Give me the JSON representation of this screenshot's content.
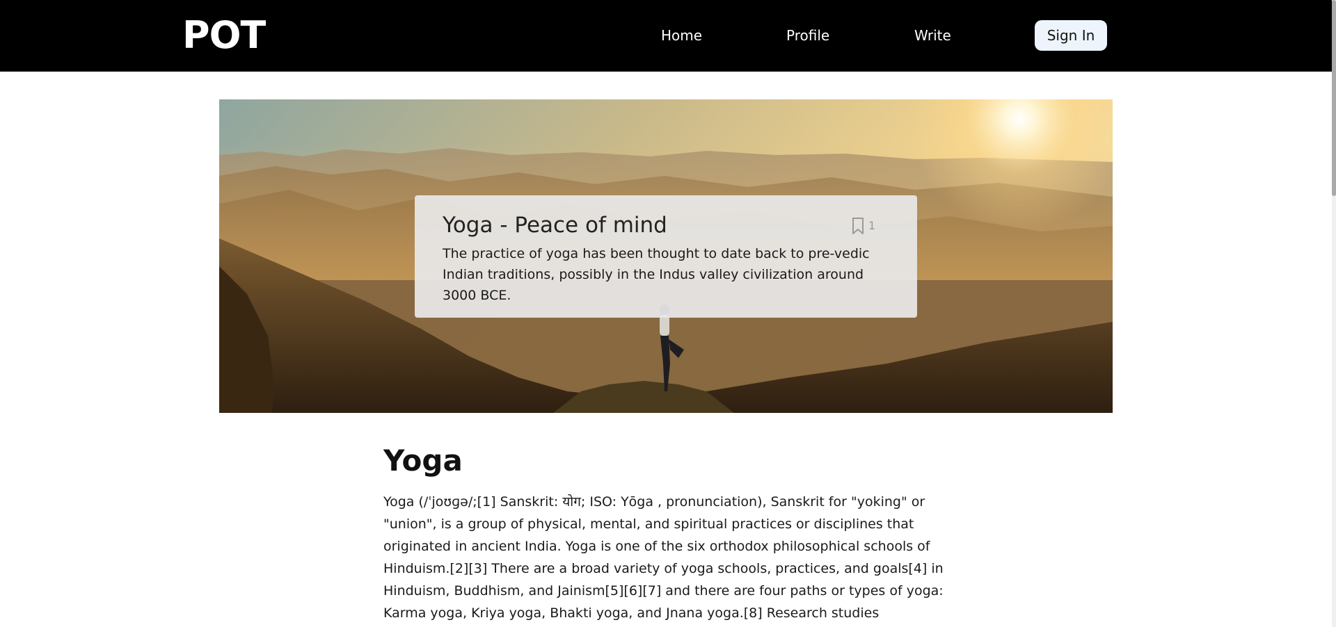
{
  "navbar": {
    "logo": "POT",
    "links": [
      {
        "label": "Home"
      },
      {
        "label": "Profile"
      },
      {
        "label": "Write"
      }
    ],
    "signin_label": "Sign In"
  },
  "hero": {
    "card": {
      "title": "Yoga - Peace of mind",
      "bookmark_icon": "bookmark-icon",
      "bookmark_count": "1",
      "description": "The practice of yoga has been thought to date back to pre-vedic Indian traditions, possibly in the Indus valley civilization around 3000 BCE."
    }
  },
  "article": {
    "title": "Yoga",
    "body": "Yoga (/ˈjoʊɡə/;[1] Sanskrit: योग; ISO: Yōga , pronunciation), Sanskrit for \"yoking\" or \"union\", is a group of physical, mental, and spiritual practices or disciplines that originated in ancient India. Yoga is one of the six orthodox philosophical schools of Hinduism.[2][3] There are a broad variety of yoga schools, practices, and goals[4] in Hinduism, Buddhism, and Jainism[5][6][7] and there are four paths or types of yoga: Karma yoga, Kriya yoga, Bhakti yoga, and Jnana yoga.[8] Research studies"
  },
  "colors": {
    "navbar_bg": "#000000",
    "signin_bg": "#eef4fb",
    "card_bg": "#e8e8e8"
  }
}
